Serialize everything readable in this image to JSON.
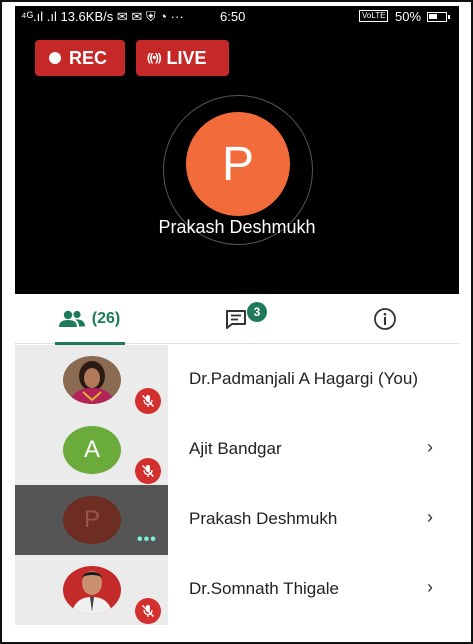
{
  "status_bar": {
    "left_text": "⁴ᴳ.ıl .ıl 13.6KB/s ✉ ✉ ⛨ ◔ ···",
    "time": "6:50",
    "volte": "VoLTE",
    "battery": "50%"
  },
  "controls": {
    "rec_label": "REC",
    "live_label": "LIVE",
    "live_icon": "((•))",
    "rec_color": "#c62828"
  },
  "speaker": {
    "initial": "P",
    "name": "Prakash Deshmukh",
    "avatar_color": "#f26b3a"
  },
  "tabs": {
    "people_count": "(26)",
    "chat_badge": "3",
    "accent": "#1f7a5c"
  },
  "participants": [
    {
      "name": "Dr.Padmanjali A Hagargi (You)",
      "avatar": "photo-woman",
      "muted": true
    },
    {
      "name": "Ajit Bandgar",
      "avatar_initial": "A",
      "avatar_color": "#6aab3c",
      "muted": true
    },
    {
      "name": "Prakash Deshmukh",
      "avatar_initial": "P",
      "avatar_color": "#6e2d22",
      "speaking": true
    },
    {
      "name": "Dr.Somnath Thigale",
      "avatar": "photo-man",
      "muted": true
    }
  ],
  "chevron": "›"
}
